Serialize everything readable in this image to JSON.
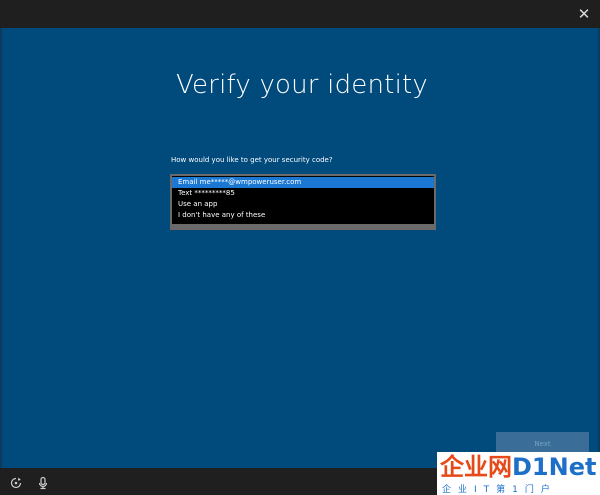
{
  "window": {
    "close_glyph": "✕"
  },
  "page": {
    "title": "Verify your identity",
    "question": "How would you like to get your security code?",
    "selected_index": 0,
    "options": [
      "Email me*****@wmpoweruser.com",
      "Text *********85",
      "Use an app",
      "I don't have any of these"
    ],
    "next_label": "Next"
  },
  "bottom_bar": {
    "icons": [
      "ease-of-access-icon",
      "microphone-icon"
    ]
  },
  "watermark": {
    "brand_cn": "企业网",
    "brand_di": "D1",
    "brand_net": "Net",
    "tagline": "企业IT第1门户"
  },
  "colors": {
    "panel": "#014a7c",
    "selection": "#1a78d2",
    "button": "#3a6e98",
    "chrome": "#1f1f1f"
  }
}
